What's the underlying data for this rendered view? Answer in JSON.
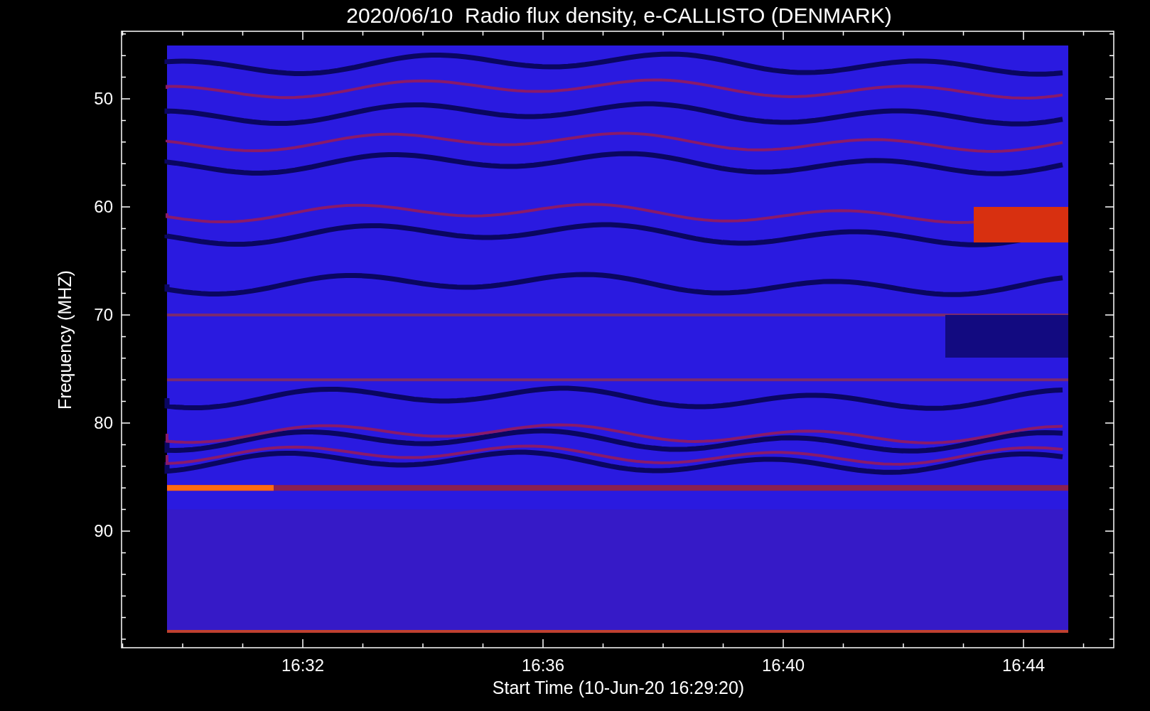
{
  "plot": {
    "title": "2020/06/10  Radio flux density, e-CALLISTO (DENMARK)",
    "xlabel": "Start Time (10-Jun-20 16:29:20)",
    "ylabel": "Frequency (MHZ)",
    "x_tick_labels": [
      "16:32",
      "16:36",
      "16:40",
      "16:44"
    ],
    "y_tick_labels": [
      "50",
      "60",
      "70",
      "80",
      "90"
    ]
  }
}
